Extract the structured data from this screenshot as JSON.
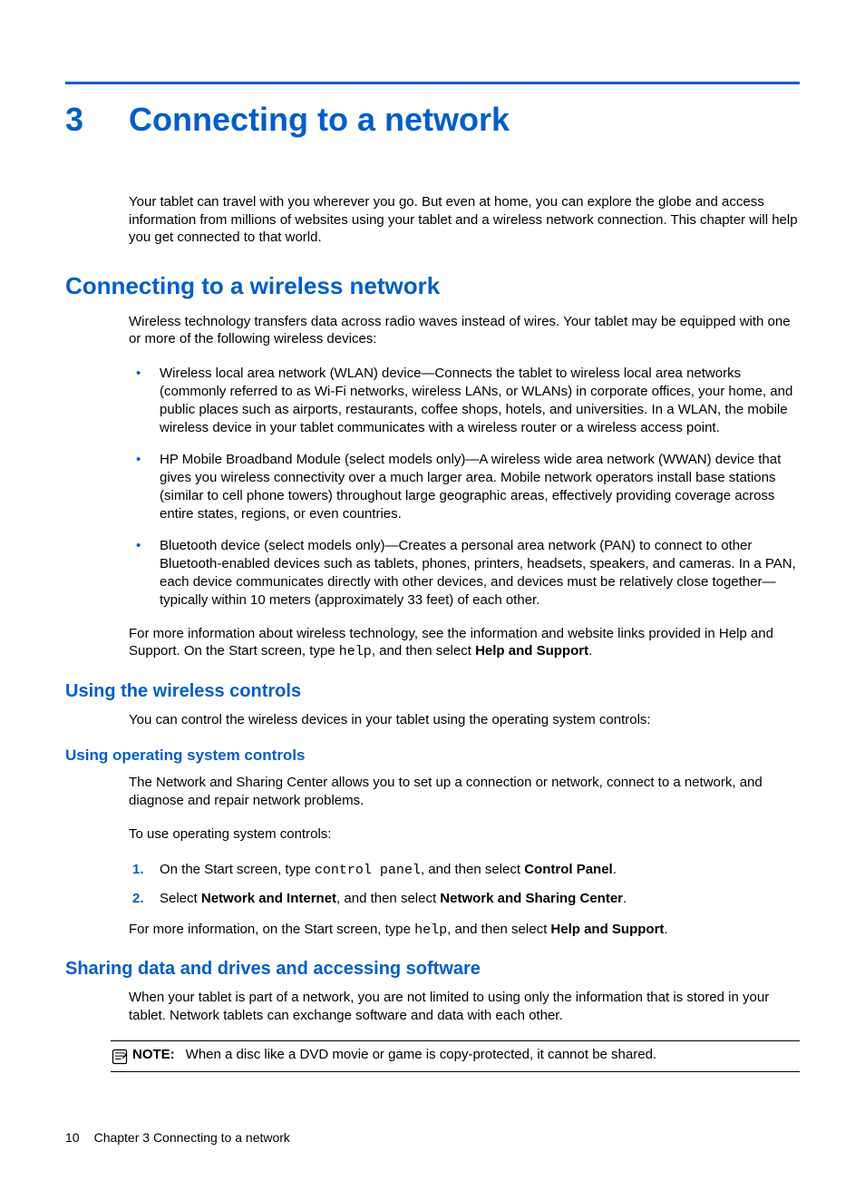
{
  "chapter": {
    "number": "3",
    "title": "Connecting to a network"
  },
  "intro": "Your tablet can travel with you wherever you go. But even at home, you can explore the globe and access information from millions of websites using your tablet and a wireless network connection. This chapter will help you get connected to that world.",
  "section1": {
    "heading": "Connecting to a wireless network",
    "intro": "Wireless technology transfers data across radio waves instead of wires. Your tablet may be equipped with one or more of the following wireless devices:",
    "bullets": {
      "b1": "Wireless local area network (WLAN) device—Connects the tablet to wireless local area networks (commonly referred to as Wi-Fi networks, wireless LANs, or WLANs) in corporate offices, your home, and public places such as airports, restaurants, coffee shops, hotels, and universities. In a WLAN, the mobile wireless device in your tablet communicates with a wireless router or a wireless access point.",
      "b2": "HP Mobile Broadband Module (select models only)—A wireless wide area network (WWAN) device that gives you wireless connectivity over a much larger area. Mobile network operators install base stations (similar to cell phone towers) throughout large geographic areas, effectively providing coverage across entire states, regions, or even countries.",
      "b3": "Bluetooth device (select models only)—Creates a personal area network (PAN) to connect to other Bluetooth-enabled devices such as tablets, phones, printers, headsets, speakers, and cameras. In a PAN, each device communicates directly with other devices, and devices must be relatively close together—typically within 10 meters (approximately 33 feet) of each other."
    },
    "moreinfo": {
      "pre": "For more information about wireless technology, see the information and website links provided in Help and Support. On the Start screen, type ",
      "code": "help",
      "mid": ", and then select ",
      "bold": "Help and Support",
      "post": "."
    }
  },
  "section2": {
    "heading": "Using the wireless controls",
    "text": "You can control the wireless devices in your tablet using the operating system controls:"
  },
  "section3": {
    "heading": "Using operating system controls",
    "p1": "The Network and Sharing Center allows you to set up a connection or network, connect to a network, and diagnose and repair network problems.",
    "p2": "To use operating system controls:",
    "step1": {
      "pre": "On the Start screen, type ",
      "code": "control panel",
      "mid": ", and then select ",
      "bold": "Control Panel",
      "post": "."
    },
    "step2": {
      "pre": "Select ",
      "bold1": "Network and Internet",
      "mid": ", and then select ",
      "bold2": "Network and Sharing Center",
      "post": "."
    },
    "moreinfo": {
      "pre": "For more information, on the Start screen, type ",
      "code": "help",
      "mid": ", and then select ",
      "bold": "Help and Support",
      "post": "."
    }
  },
  "section4": {
    "heading": "Sharing data and drives and accessing software",
    "p1": "When your tablet is part of a network, you are not limited to using only the information that is stored in your tablet. Network tablets can exchange software and data with each other.",
    "note": {
      "label": "NOTE:",
      "text": "When a disc like a DVD movie or game is copy-protected, it cannot be shared."
    }
  },
  "footer": {
    "page": "10",
    "text": "Chapter 3   Connecting to a network"
  }
}
